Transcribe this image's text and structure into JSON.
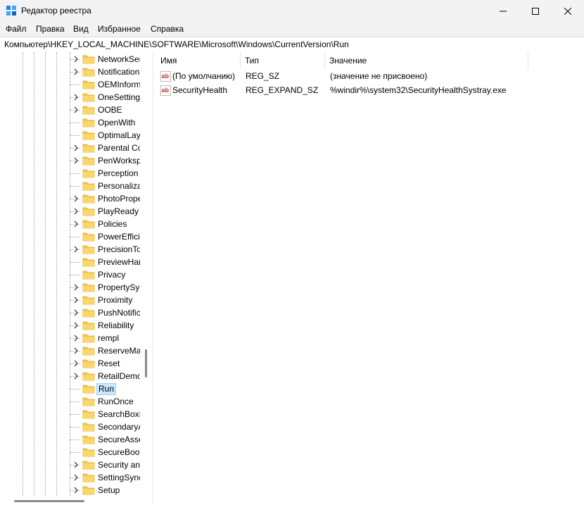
{
  "window": {
    "title": "Редактор реестра",
    "icon": "registry-editor-icon",
    "controls": [
      "minimize-icon",
      "maximize-icon",
      "close-icon"
    ]
  },
  "menu": [
    "Файл",
    "Правка",
    "Вид",
    "Избранное",
    "Справка"
  ],
  "address": "Компьютер\\HKEY_LOCAL_MACHINE\\SOFTWARE\\Microsoft\\Windows\\CurrentVersion\\Run",
  "tree": {
    "items": [
      {
        "label": "NetworkSer",
        "expandable": true
      },
      {
        "label": "Notification",
        "expandable": true
      },
      {
        "label": "OEMInform",
        "expandable": false
      },
      {
        "label": "OneSetting",
        "expandable": true
      },
      {
        "label": "OOBE",
        "expandable": true
      },
      {
        "label": "OpenWith",
        "expandable": false
      },
      {
        "label": "OptimalLay",
        "expandable": false
      },
      {
        "label": "Parental Co",
        "expandable": true
      },
      {
        "label": "PenWorksp",
        "expandable": true
      },
      {
        "label": "Perception",
        "expandable": false
      },
      {
        "label": "Personaliza",
        "expandable": false
      },
      {
        "label": "PhotoPrope",
        "expandable": true
      },
      {
        "label": "PlayReady",
        "expandable": true
      },
      {
        "label": "Policies",
        "expandable": true
      },
      {
        "label": "PowerEffici",
        "expandable": false
      },
      {
        "label": "PrecisionTo",
        "expandable": true
      },
      {
        "label": "PreviewHan",
        "expandable": false
      },
      {
        "label": "Privacy",
        "expandable": false
      },
      {
        "label": "PropertySys",
        "expandable": true
      },
      {
        "label": "Proximity",
        "expandable": true
      },
      {
        "label": "PushNotific",
        "expandable": true
      },
      {
        "label": "Reliability",
        "expandable": true
      },
      {
        "label": "rempl",
        "expandable": true
      },
      {
        "label": "ReserveMar",
        "expandable": true
      },
      {
        "label": "Reset",
        "expandable": true
      },
      {
        "label": "RetailDemo",
        "expandable": true
      },
      {
        "label": "Run",
        "expandable": false,
        "selected": true
      },
      {
        "label": "RunOnce",
        "expandable": false
      },
      {
        "label": "SearchBoxE",
        "expandable": false
      },
      {
        "label": "SecondaryA",
        "expandable": false
      },
      {
        "label": "SecureAsse",
        "expandable": false
      },
      {
        "label": "SecureBoot",
        "expandable": false
      },
      {
        "label": "Security an",
        "expandable": true
      },
      {
        "label": "SettingSync",
        "expandable": true
      },
      {
        "label": "Setup",
        "expandable": true
      }
    ]
  },
  "columns": [
    "Имя",
    "Тип",
    "Значение"
  ],
  "values": [
    {
      "name": "(По умолчанию)",
      "type": "REG_SZ",
      "data": "(значение не присвоено)",
      "icon": "string-value-icon"
    },
    {
      "name": "SecurityHealth",
      "type": "REG_EXPAND_SZ",
      "data": "%windir%\\system32\\SecurityHealthSystray.exe",
      "icon": "string-value-icon"
    }
  ],
  "colors": {
    "titlebar": "#f3f3f3",
    "folder": "#f8c84a",
    "selection": "#cce8ff",
    "ab_icon": "#c0392b"
  }
}
